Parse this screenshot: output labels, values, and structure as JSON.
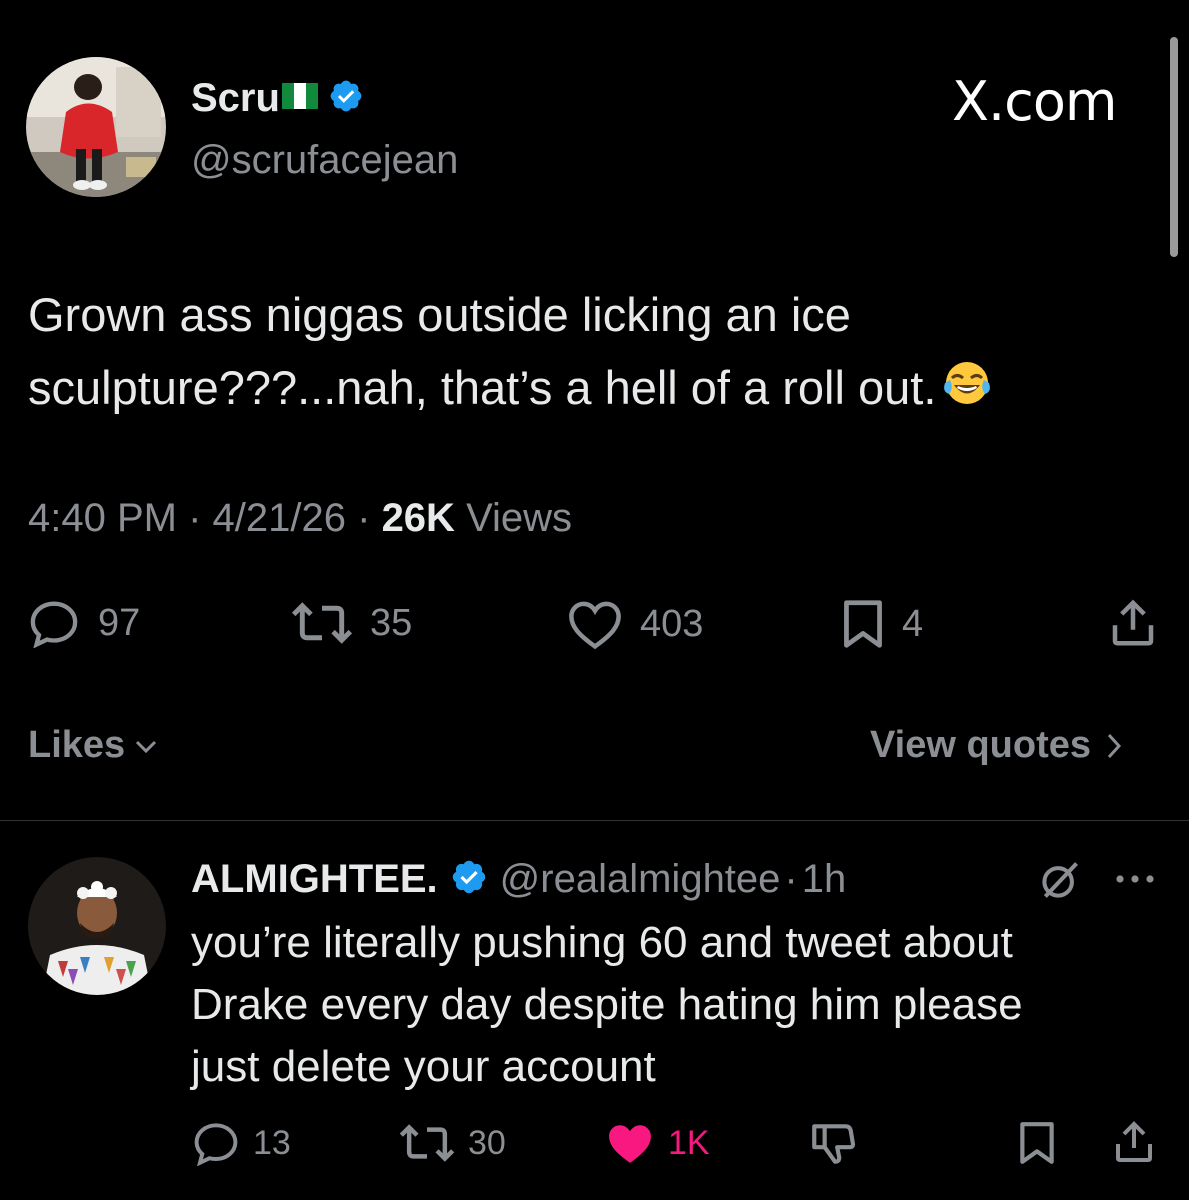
{
  "tweet": {
    "display_name": "Scru",
    "handle": "@scrufacejean",
    "text_line1": "Grown ass niggas outside licking an ice",
    "text_line2": "sculpture???...nah, that’s a hell of a roll out.",
    "time": "4:40 PM",
    "date": "4/21/26",
    "views_count": "26K",
    "views_label": "Views",
    "replies": "97",
    "reposts": "35",
    "likes": "403",
    "bookmarks": "4"
  },
  "brand": {
    "logo_text": "X.com"
  },
  "links": {
    "likes_label": "Likes",
    "view_quotes_label": "View quotes"
  },
  "reply": {
    "display_name": "ALMIGHTEE.",
    "handle": "@realalmightee",
    "time": "1h",
    "text_line1": "you’re literally pushing 60 and tweet about",
    "text_line2": "Drake every day despite hating him please",
    "text_line3": "just delete your account",
    "replies": "13",
    "reposts": "30",
    "likes": "1K"
  },
  "colors": {
    "background": "#000000",
    "text_primary": "#e7e9ea",
    "text_secondary": "#8b8f94",
    "verified": "#1d9bf0",
    "like_pink": "#f91880",
    "divider": "#2f3336"
  },
  "icons": {
    "flag": "nigeria-flag-icon",
    "verified": "verified-badge-icon",
    "reply": "reply-icon",
    "repost": "repost-icon",
    "like": "heart-icon",
    "bookmark": "bookmark-icon",
    "share": "share-icon",
    "emoji": "tears-of-joy-emoji"
  }
}
